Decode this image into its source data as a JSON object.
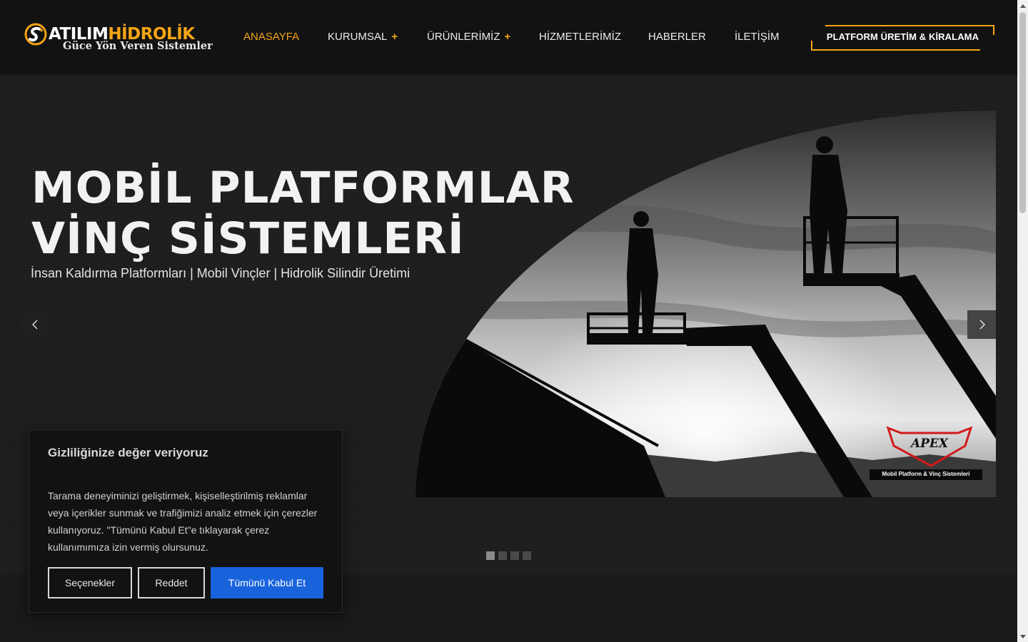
{
  "brand": {
    "name_part1": "ATILIM",
    "name_part2": "HİDROLİK",
    "tagline": "Güce Yön Veren Sistemler",
    "accent_color": "#f5a414"
  },
  "nav": {
    "items": [
      {
        "label": "ANASAYFA",
        "active": true,
        "has_submenu": false
      },
      {
        "label": "KURUMSAL",
        "active": false,
        "has_submenu": true
      },
      {
        "label": "ÜRÜNLERİMİZ",
        "active": false,
        "has_submenu": true
      },
      {
        "label": "HİZMETLERİMİZ",
        "active": false,
        "has_submenu": false
      },
      {
        "label": "HABERLER",
        "active": false,
        "has_submenu": false
      },
      {
        "label": "İLETİŞİM",
        "active": false,
        "has_submenu": false
      }
    ],
    "submenu_marker": "+",
    "cta_label": "PLATFORM ÜRETİM & KİRALAMA"
  },
  "hero": {
    "title_line1": "MOBİL PLATFORMLAR",
    "title_line2": "VİNÇ SİSTEMLERİ",
    "subtitle": "İnsan Kaldırma Platformları | Mobil Vinçler | Hidrolik Silindir Üretimi",
    "image_badge_name": "APEX",
    "image_badge_caption": "Mobil Platform & Vinç Sistemleri",
    "slides_count": 4,
    "active_slide": 1,
    "prev_icon": "chevron-left-icon",
    "next_icon": "chevron-right-icon"
  },
  "cookie_banner": {
    "title": "Gizliliğinize değer veriyoruz",
    "body": "Tarama deneyiminizi geliştirmek, kişiselleştirilmiş reklamlar veya içerikler sunmak ve trafiğimizi analiz etmek için çerezler kullanıyoruz. \"Tümünü Kabul Et\"e tıklayarak çerez kullanımımıza izin vermiş olursunuz.",
    "options_label": "Seçenekler",
    "reject_label": "Reddet",
    "accept_label": "Tümünü Kabul Et",
    "accept_color": "#1863dc"
  }
}
